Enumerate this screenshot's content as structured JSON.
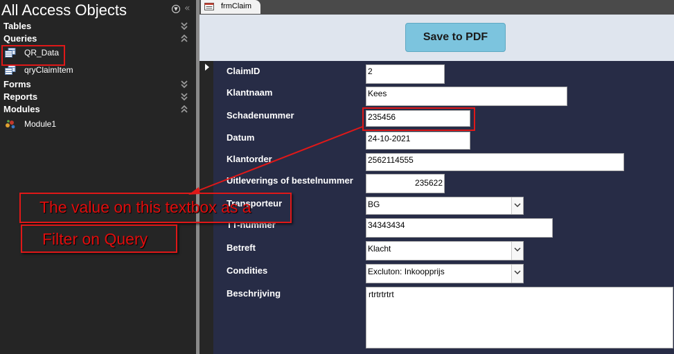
{
  "nav": {
    "title": "All Access Objects",
    "groups": {
      "tables": "Tables",
      "queries": "Queries",
      "forms": "Forms",
      "reports": "Reports",
      "modules": "Modules"
    },
    "queries": [
      "QR_Data",
      "qryClaimItem"
    ],
    "modules": [
      "Module1"
    ]
  },
  "tab": {
    "label": "frmClaim"
  },
  "header": {
    "save_button": "Save to PDF"
  },
  "form": {
    "claim_id": {
      "label": "ClaimID",
      "value": "2"
    },
    "klantnaam": {
      "label": "Klantnaam",
      "value": "Kees"
    },
    "schadenummer": {
      "label": "Schadenummer",
      "value": "235456"
    },
    "datum": {
      "label": "Datum",
      "value": "24-10-2021"
    },
    "klantorder": {
      "label": "Klantorder",
      "value": "2562114555"
    },
    "uitlevering": {
      "label": "Uitleverings of bestelnummer",
      "value": "235622"
    },
    "transporteur": {
      "label": "Transporteur",
      "value": "BG"
    },
    "tt_nummer": {
      "label": "TT-nummer",
      "value": "34343434"
    },
    "betreft": {
      "label": "Betreft",
      "value": "Klacht"
    },
    "condities": {
      "label": "Condities",
      "value": "Excluton: Inkoopprijs"
    },
    "beschrijving": {
      "label": "Beschrijving",
      "value": "rtrtrtrtrt"
    }
  },
  "annotation": {
    "line1": "The value on this textbox as a",
    "line2": "Filter on Query",
    "color": "#e01818"
  }
}
